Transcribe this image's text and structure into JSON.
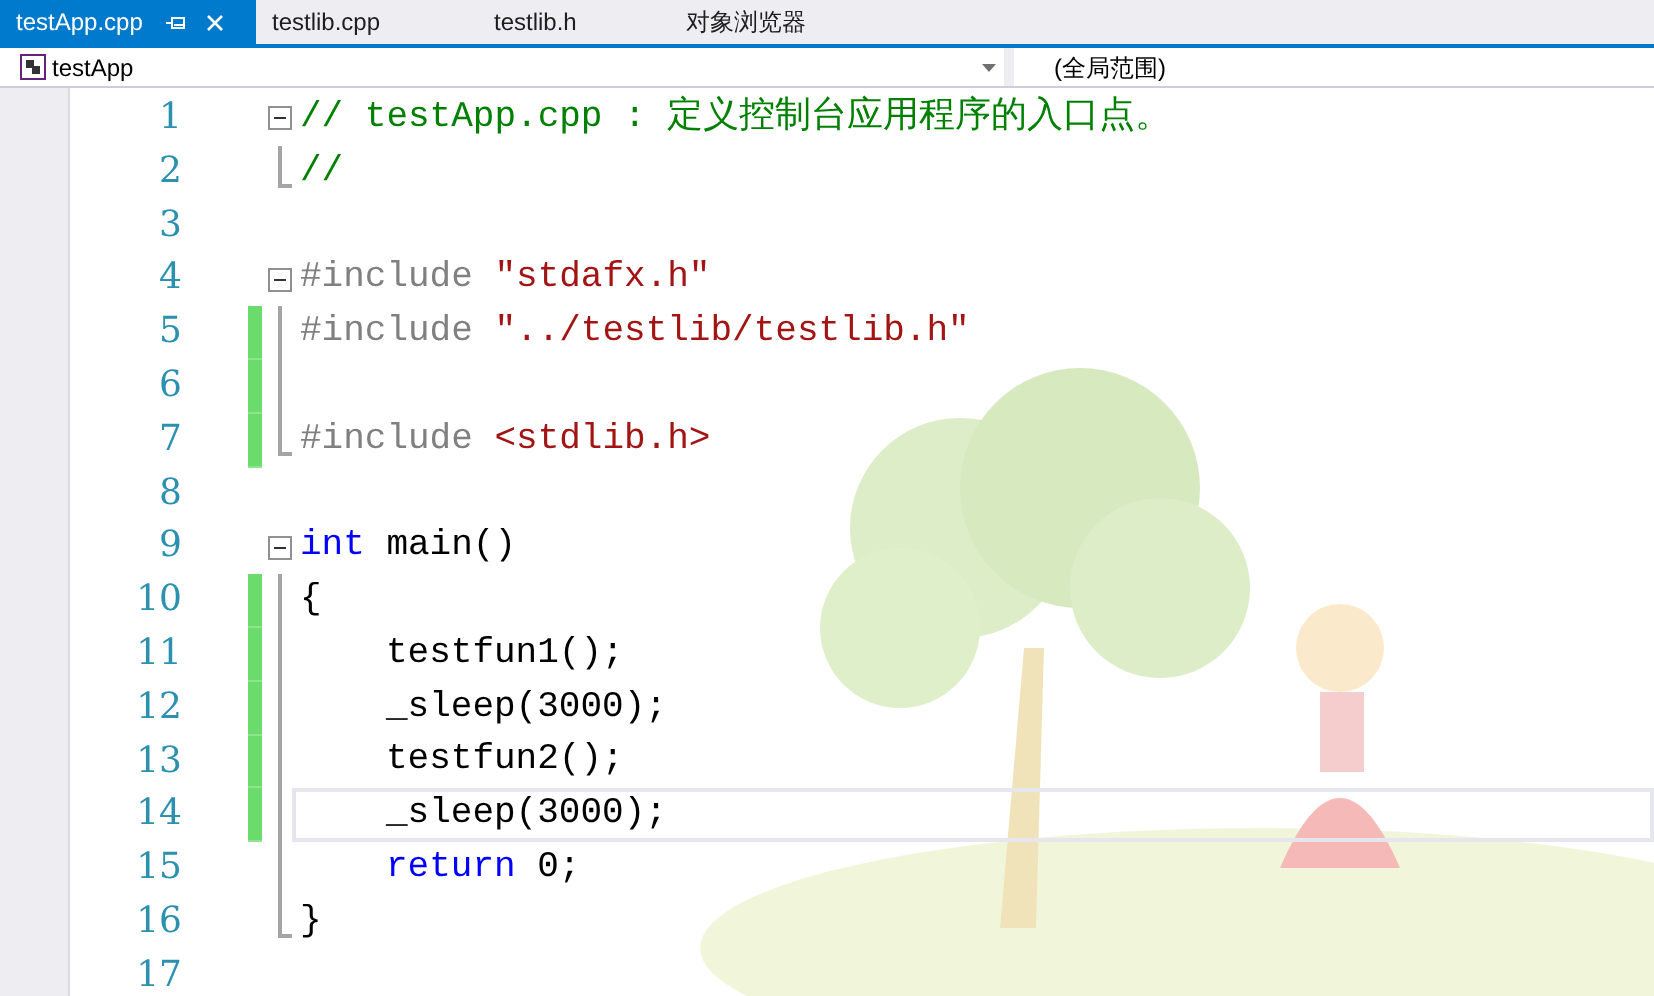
{
  "tabs": [
    {
      "label": "testApp.cpp",
      "selected": true,
      "pinnable": true
    },
    {
      "label": "testlib.cpp",
      "selected": false,
      "pinnable": false
    },
    {
      "label": "testlib.h",
      "selected": false,
      "pinnable": false
    },
    {
      "label": "对象浏览器",
      "selected": false,
      "pinnable": false
    }
  ],
  "navigation_bar": {
    "project": "testApp",
    "scope": "(全局范围)"
  },
  "editor": {
    "lines": [
      {
        "number": "1",
        "kind": "fold_start",
        "nested": false,
        "changed": false,
        "current": false,
        "tokens": [
          {
            "kind": "comment",
            "text": "// testApp.cpp : 定义控制台应用程序的入口点。"
          }
        ]
      },
      {
        "number": "2",
        "kind": "fold_end",
        "nested": false,
        "changed": false,
        "current": false,
        "tokens": [
          {
            "kind": "comment",
            "text": "//"
          }
        ]
      },
      {
        "number": "3",
        "kind": "plain",
        "nested": false,
        "changed": false,
        "current": false
      },
      {
        "number": "4",
        "kind": "fold_start",
        "nested": false,
        "changed": false,
        "current": false,
        "tokens": [
          {
            "kind": "preprocessor",
            "text": "#include "
          },
          {
            "kind": "string",
            "text": "\"stdafx.h\""
          }
        ]
      },
      {
        "number": "5",
        "kind": "fold_body",
        "nested": false,
        "changed": true,
        "current": false,
        "tokens": [
          {
            "kind": "preprocessor",
            "text": "#include "
          },
          {
            "kind": "string",
            "text": "\"../testlib/testlib.h\""
          }
        ]
      },
      {
        "number": "6",
        "kind": "fold_body",
        "nested": false,
        "changed": true,
        "current": false
      },
      {
        "number": "7",
        "kind": "fold_end",
        "nested": false,
        "changed": true,
        "current": false,
        "tokens": [
          {
            "kind": "preprocessor",
            "text": "#include "
          },
          {
            "kind": "string",
            "text": "<stdlib.h>"
          }
        ]
      },
      {
        "number": "8",
        "kind": "plain",
        "nested": false,
        "changed": false,
        "current": false
      },
      {
        "number": "9",
        "kind": "fold_start",
        "nested": false,
        "changed": false,
        "current": false,
        "tokens": [
          {
            "kind": "keyword",
            "text": "int"
          },
          {
            "kind": "plain",
            "text": " main()"
          }
        ]
      },
      {
        "number": "10",
        "kind": "fold_body",
        "nested": false,
        "changed": true,
        "current": false,
        "tokens": [
          {
            "kind": "plain",
            "text": "{"
          }
        ]
      },
      {
        "number": "11",
        "kind": "fold_body",
        "nested": true,
        "changed": true,
        "current": false,
        "tokens": [
          {
            "kind": "plain",
            "text": "testfun1();"
          }
        ]
      },
      {
        "number": "12",
        "kind": "fold_body",
        "nested": true,
        "changed": true,
        "current": false,
        "tokens": [
          {
            "kind": "plain",
            "text": "_sleep(3000);"
          }
        ]
      },
      {
        "number": "13",
        "kind": "fold_body",
        "nested": true,
        "changed": true,
        "current": false,
        "tokens": [
          {
            "kind": "plain",
            "text": "testfun2();"
          }
        ]
      },
      {
        "number": "14",
        "kind": "fold_body",
        "nested": true,
        "changed": true,
        "current": true,
        "tokens": [
          {
            "kind": "plain",
            "text": "_sleep(3000);"
          }
        ]
      },
      {
        "number": "15",
        "kind": "fold_body",
        "nested": true,
        "changed": false,
        "current": false,
        "tokens": [
          {
            "kind": "keyword",
            "text": "return"
          },
          {
            "kind": "plain",
            "text": " 0;"
          }
        ]
      },
      {
        "number": "16",
        "kind": "fold_end",
        "nested": false,
        "changed": false,
        "current": false,
        "tokens": [
          {
            "kind": "plain",
            "text": "}"
          }
        ]
      },
      {
        "number": "17",
        "kind": "plain",
        "nested": false,
        "changed": false,
        "current": false
      }
    ]
  }
}
